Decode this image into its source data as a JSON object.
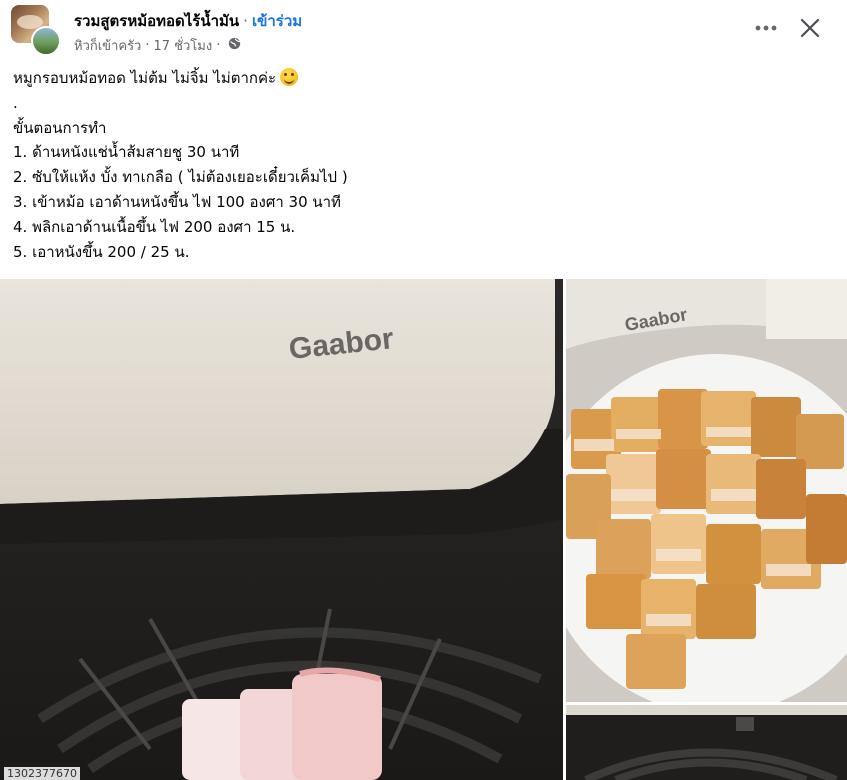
{
  "header": {
    "group_name": "รวมสูตรหม้อทอดไร้น้ำมัน",
    "separator": "·",
    "join_label": "เข้าร่วม",
    "author": "หิวก็เข้าครัว",
    "time": "17 ชั่วโมง",
    "audience_icon": "globe-icon",
    "more_icon": "more-icon",
    "close_icon": "close-icon"
  },
  "post": {
    "title": "หมูกรอบหม้อทอด ไม่ต้ม ไม่จิ้ม ไม่ตากค่ะ",
    "title_emoji": "smiling-face-emoji",
    "dot_line": ".",
    "steps_heading": "ขั้นตอนการทำ",
    "steps": [
      "1. ด้านหนังแช่น้ำส้มสายชู 30 นาที",
      "2. ซับให้แห้ง บั้ง ทาเกลือ ( ไม่ต้องเยอะเดี๋ยวเค็มไป )",
      "3. เข้าหม้อ เอาด้านหนังขึ้น ไฟ 100 องศา 30 นาที",
      "4. พลิกเอาด้านเนื้อขึ้น ไฟ 200 องศา 15 น.",
      "5. เอาหนังขึ้น 200 / 25 น."
    ]
  },
  "photos": {
    "main_brand_text": "Gaabor",
    "plate_brand_text": "Gaabor",
    "main_id_text": "1302377670"
  },
  "colors": {
    "link": "#1b74e4",
    "secondary_text": "#65676b",
    "primary_text": "#050505"
  }
}
